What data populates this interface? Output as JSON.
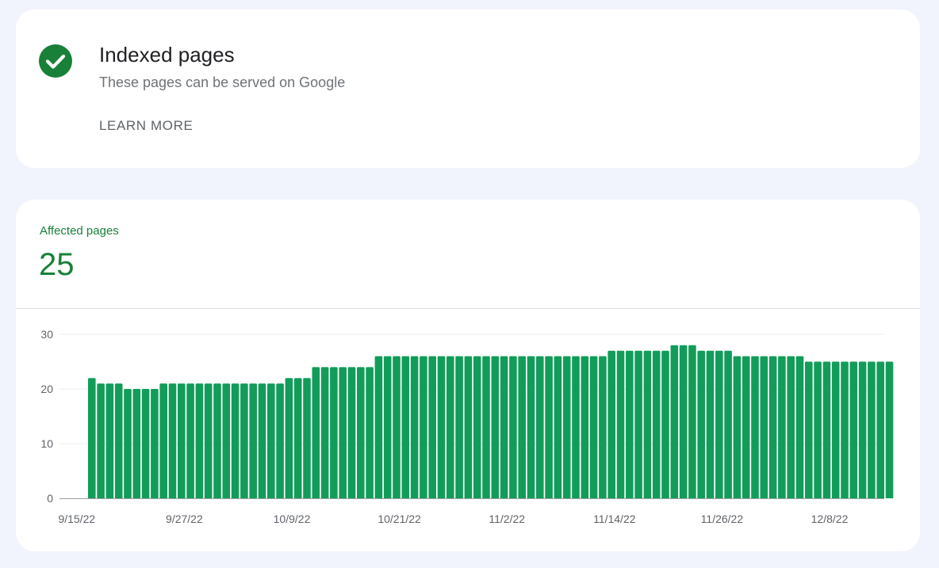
{
  "status_card": {
    "icon": "check-circle-icon",
    "title": "Indexed pages",
    "subtitle": "These pages can be served on Google",
    "learn_more": "LEARN MORE",
    "accent_color": "#188038"
  },
  "metric": {
    "label": "Affected pages",
    "value": "25"
  },
  "chart_data": {
    "type": "bar",
    "bar_color": "#129c5a",
    "ylim": [
      0,
      30
    ],
    "y_ticks": [
      "0",
      "10",
      "20",
      "30"
    ],
    "x_tick_labels": [
      "9/15/22",
      "9/27/22",
      "10/9/22",
      "10/21/22",
      "11/2/22",
      "11/14/22",
      "11/26/22",
      "12/8/22"
    ],
    "values": [
      22,
      21,
      21,
      21,
      20,
      20,
      20,
      20,
      21,
      21,
      21,
      21,
      21,
      21,
      21,
      21,
      21,
      21,
      21,
      21,
      21,
      21,
      22,
      22,
      22,
      24,
      24,
      24,
      24,
      24,
      24,
      24,
      26,
      26,
      26,
      26,
      26,
      26,
      26,
      26,
      26,
      26,
      26,
      26,
      26,
      26,
      26,
      26,
      26,
      26,
      26,
      26,
      26,
      26,
      26,
      26,
      26,
      26,
      27,
      27,
      27,
      27,
      27,
      27,
      27,
      28,
      28,
      28,
      27,
      27,
      27,
      27,
      26,
      26,
      26,
      26,
      26,
      26,
      26,
      26,
      25,
      25,
      25,
      25,
      25,
      25,
      25,
      25,
      25,
      25
    ],
    "grid": true
  }
}
